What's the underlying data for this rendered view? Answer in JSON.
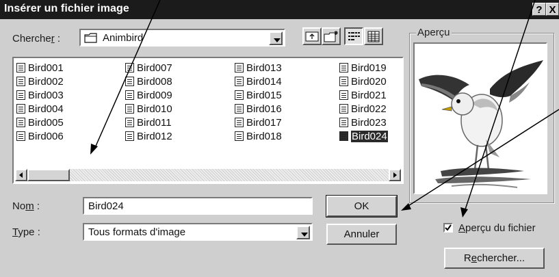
{
  "window": {
    "title": "Insérer un fichier image",
    "help_button": "?",
    "close_button": "X"
  },
  "look_in": {
    "label_prefix": "Cherche",
    "label_underlined": "r",
    "label_suffix": " :",
    "value": "Animbird"
  },
  "files": [
    [
      "Bird001",
      "Bird002",
      "Bird003",
      "Bird004",
      "Bird005",
      "Bird006"
    ],
    [
      "Bird007",
      "Bird008",
      "Bird009",
      "Bird010",
      "Bird011",
      "Bird012"
    ],
    [
      "Bird013",
      "Bird014",
      "Bird015",
      "Bird016",
      "Bird017",
      "Bird018"
    ],
    [
      "Bird019",
      "Bird020",
      "Bird021",
      "Bird022",
      "Bird023",
      "Bird024"
    ]
  ],
  "selected_file": "Bird024",
  "filename": {
    "label_prefix": "No",
    "label_underlined": "m",
    "label_suffix": " :",
    "value": "Bird024"
  },
  "filetype": {
    "label_underlined": "T",
    "label_suffix": "ype :",
    "value": "Tous formats d'image"
  },
  "buttons": {
    "ok": "OK",
    "cancel": "Annuler",
    "search_prefix": "R",
    "search_underlined": "e",
    "search_suffix": "chercher..."
  },
  "preview": {
    "label": "Aperçu"
  },
  "preview_check": {
    "underlined": "A",
    "rest": "perçu du fichier",
    "checked": true
  }
}
